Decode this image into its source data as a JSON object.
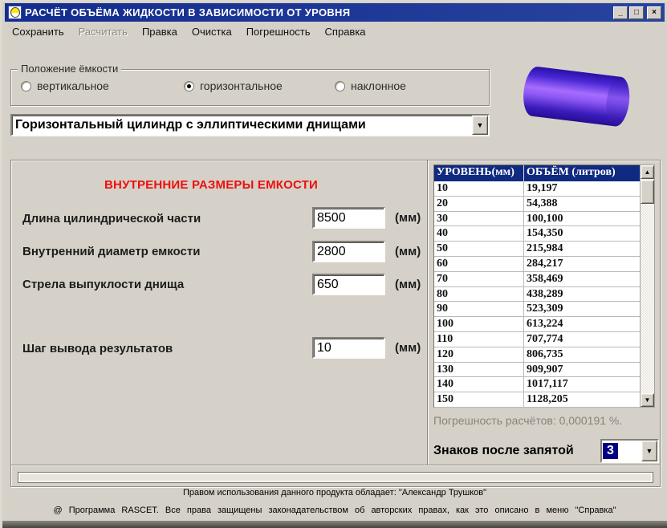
{
  "window": {
    "title": "РАСЧЁТ ОБЪЁМА ЖИДКОСТИ В ЗАВИСИМОСТИ ОТ УРОВНЯ",
    "controls": {
      "minimize": "_",
      "maximize": "□",
      "close": "×"
    }
  },
  "menu": {
    "items": [
      {
        "label": "Сохранить",
        "enabled": true
      },
      {
        "label": "Расчитать",
        "enabled": false
      },
      {
        "label": "Правка",
        "enabled": true
      },
      {
        "label": "Очистка",
        "enabled": true
      },
      {
        "label": "Погрешность",
        "enabled": true
      },
      {
        "label": "Справка",
        "enabled": true
      }
    ]
  },
  "position_group": {
    "title": "Положение ёмкости",
    "options": [
      {
        "label": "вертикальное",
        "selected": false
      },
      {
        "label": "горизонтальное",
        "selected": true
      },
      {
        "label": "наклонное",
        "selected": false
      }
    ]
  },
  "tank_type": {
    "value": "Горизонтальный цилиндр с эллиптическими днищами"
  },
  "dimensions": {
    "title": "ВНУТРЕННИЕ РАЗМЕРЫ ЕМКОСТИ",
    "fields": [
      {
        "label": "Длина цилиндрической части",
        "value": "8500",
        "unit": "(мм)"
      },
      {
        "label": "Внутренний диаметр емкости",
        "value": "2800",
        "unit": "(мм)"
      },
      {
        "label": "Стрела выпуклости днища",
        "value": "650",
        "unit": "(мм)"
      },
      {
        "label": "Шаг вывода результатов",
        "value": "10",
        "unit": "(мм)"
      }
    ]
  },
  "results_table": {
    "columns": [
      "УРОВЕНЬ(мм)",
      "ОБЪЁМ (литров)"
    ],
    "rows": [
      [
        "10",
        "19,197"
      ],
      [
        "20",
        "54,388"
      ],
      [
        "30",
        "100,100"
      ],
      [
        "40",
        "154,350"
      ],
      [
        "50",
        "215,984"
      ],
      [
        "60",
        "284,217"
      ],
      [
        "70",
        "358,469"
      ],
      [
        "80",
        "438,289"
      ],
      [
        "90",
        "523,309"
      ],
      [
        "100",
        "613,224"
      ],
      [
        "110",
        "707,774"
      ],
      [
        "120",
        "806,735"
      ],
      [
        "130",
        "909,907"
      ],
      [
        "140",
        "1017,117"
      ],
      [
        "150",
        "1128,205"
      ]
    ]
  },
  "accuracy_text": "Погрешность расчётов: 0,000191 %.",
  "decimals": {
    "label": "Знаков после запятой",
    "value": "3"
  },
  "footer": {
    "line1": "Правом использования данного продукта обладает: \"Александр Трушков\"",
    "line2": "@ Программа RASCET. Все права защищены законадательством об авторских правах, как это описано в меню \"Справка\""
  },
  "colors": {
    "window_bg": "#d5d1c8",
    "titlebar_blue": "#132c8e",
    "table_header_bg": "#0f2a80",
    "accent_red": "#ee0f0f",
    "selection_blue": "#000080",
    "cylinder_dark_blue": "#2a0fa6",
    "cylinder_violet": "#a76cff"
  }
}
